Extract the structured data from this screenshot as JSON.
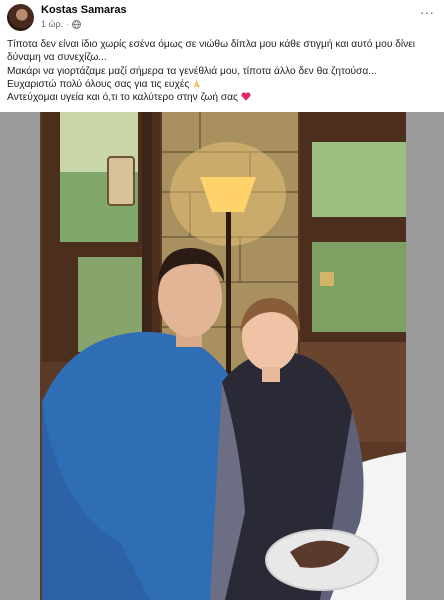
{
  "post": {
    "author": "Kostas Samaras",
    "time": "1 ώρ.",
    "separator": "·",
    "audience_icon": "globe-icon",
    "more_icon": "more-horizontal-icon",
    "more_label": "···",
    "lines": [
      "Τίποτα δεν είναι ίδιο χωρίς εσένα όμως σε νιώθω δίπλα μου κάθε στιγμή και αυτό μου δίνει δύναμη να συνεχίζω...",
      "Μακάρι να γιορτάζαμε μαζί σήμερα τα γενέθλιά μου, τίποτα άλλο δεν θα ζητούσα...",
      "Ευχαριστώ πολύ όλους σας για τις ευχές",
      "Αντεύχομαι υγεία και ό,τι το καλύτερο στην ζωή σας"
    ],
    "emoji": {
      "line3": "folded-hands-icon",
      "line4": "red-heart-icon"
    },
    "photo": {
      "subject": "couple-photo",
      "colors": {
        "background_gray": "#9a9a9a",
        "shirt_blue": "#2f6db5",
        "lamp_glow": "#ffd36b"
      }
    }
  }
}
